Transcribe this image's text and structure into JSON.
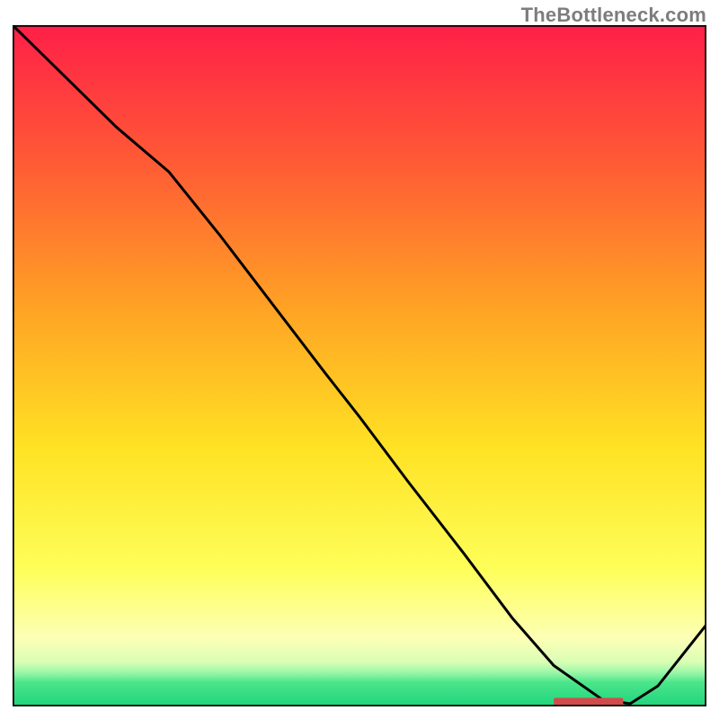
{
  "watermark": "TheBottleneck.com",
  "chart_data": {
    "type": "line",
    "title": "",
    "xlabel": "",
    "ylabel": "",
    "xlim": [
      0,
      100
    ],
    "ylim": [
      0,
      100
    ],
    "legend": false,
    "grid": false,
    "background_gradient_stops": [
      {
        "offset": 0.0,
        "color": "#ff1f48"
      },
      {
        "offset": 0.2,
        "color": "#ff5a35"
      },
      {
        "offset": 0.42,
        "color": "#ffa424"
      },
      {
        "offset": 0.62,
        "color": "#ffe224"
      },
      {
        "offset": 0.8,
        "color": "#feff5a"
      },
      {
        "offset": 0.9,
        "color": "#fdffb6"
      },
      {
        "offset": 0.935,
        "color": "#d8ffb5"
      },
      {
        "offset": 0.95,
        "color": "#9cf7a8"
      },
      {
        "offset": 0.965,
        "color": "#4be58a"
      },
      {
        "offset": 1.0,
        "color": "#1fd47c"
      }
    ],
    "series": [
      {
        "name": "bottleneck-curve",
        "color": "#000000",
        "x": [
          0.0,
          7.5,
          15.0,
          22.5,
          30.0,
          37.5,
          45.0,
          50.0,
          57.0,
          65.0,
          72.0,
          78.0,
          85.0,
          89.0,
          93.0,
          100.0
        ],
        "y": [
          100.0,
          92.5,
          85.0,
          78.5,
          69.0,
          59.0,
          49.0,
          42.5,
          33.0,
          22.5,
          13.0,
          6.0,
          1.0,
          0.4,
          3.0,
          12.0
        ]
      }
    ],
    "marker": {
      "name": "optimal-region",
      "color": "#d24a4a",
      "x_start": 78.0,
      "x_end": 88.0,
      "y": 0.7,
      "thickness": 1.1
    }
  }
}
